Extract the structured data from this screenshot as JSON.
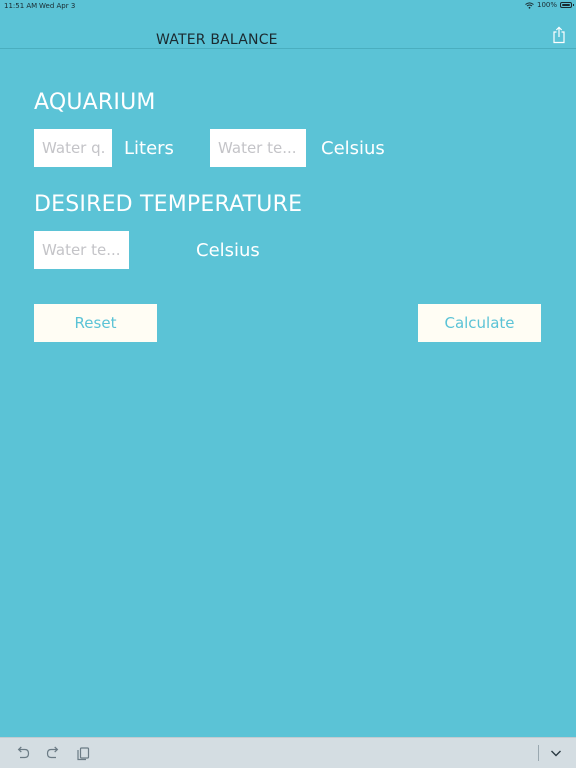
{
  "status_bar": {
    "time": "11:51 AM",
    "date": "Wed Apr 3",
    "battery": "100%"
  },
  "nav": {
    "title": "WATER BALANCE",
    "share_icon": "share-icon"
  },
  "aquarium": {
    "title": "AQUARIUM",
    "quantity_placeholder": "Water q...",
    "quantity_value": "",
    "quantity_unit": "Liters",
    "temperature_placeholder": "Water te...",
    "temperature_value": "",
    "temperature_unit": "Celsius"
  },
  "desired": {
    "title": "DESIRED TEMPERATURE",
    "temperature_placeholder": "Water te...",
    "temperature_value": "",
    "temperature_unit": "Celsius"
  },
  "actions": {
    "reset_label": "Reset",
    "calculate_label": "Calculate"
  },
  "toolbar": {
    "icons": [
      "undo-icon",
      "redo-icon",
      "paste-icon",
      "keyboard-dismiss-icon"
    ]
  },
  "colors": {
    "background": "#5bc3d6",
    "button_background": "#fffdf4",
    "button_text": "#5bc3d6",
    "title_text": "#1b2a30"
  }
}
